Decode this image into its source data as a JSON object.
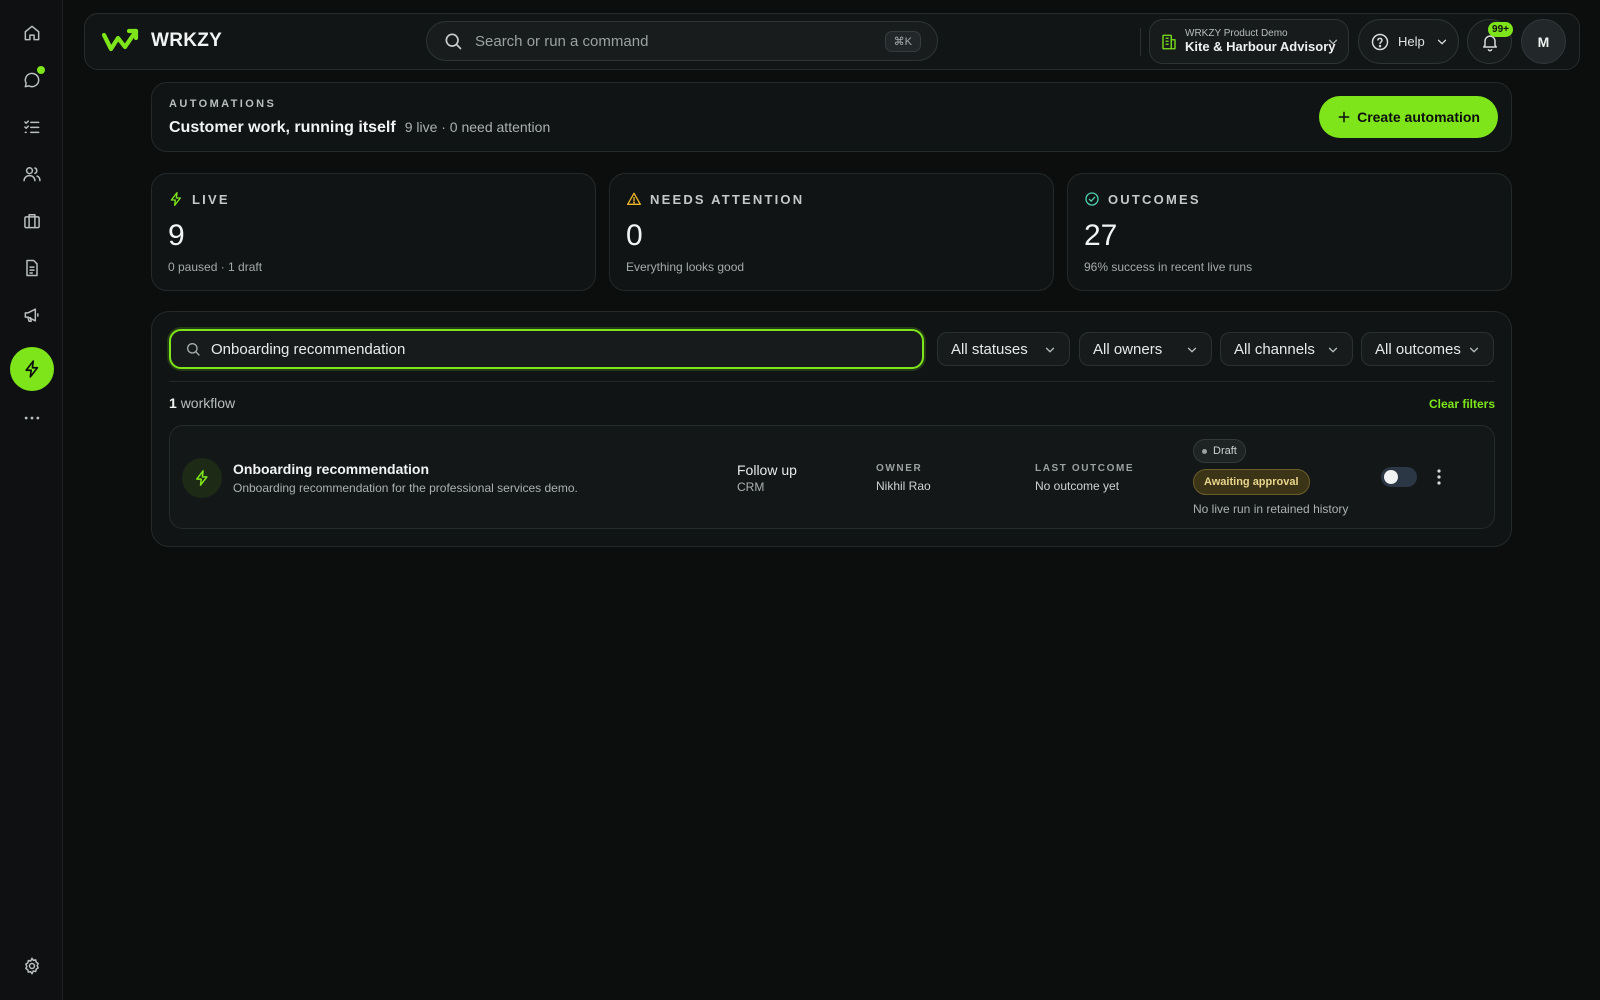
{
  "brand": {
    "name": "WRKZY"
  },
  "command_bar": {
    "placeholder": "Search or run a command",
    "shortcut": "⌘K"
  },
  "workspace": {
    "label_small": "WRKZY Product Demo",
    "name": "Kite & Harbour Advisory"
  },
  "help": {
    "label": "Help"
  },
  "notifications": {
    "badge": "99+"
  },
  "user": {
    "initial": "M"
  },
  "rail": {
    "items": [
      {
        "icon": "home-icon"
      },
      {
        "icon": "chat-icon",
        "has_dot": true
      },
      {
        "icon": "tasks-icon"
      },
      {
        "icon": "contacts-icon"
      },
      {
        "icon": "briefcase-icon"
      },
      {
        "icon": "document-icon"
      },
      {
        "icon": "megaphone-icon"
      },
      {
        "icon": "lightning-icon",
        "active": true
      },
      {
        "icon": "more-icon"
      }
    ],
    "bottom": {
      "icon": "settings-icon"
    }
  },
  "header": {
    "eyebrow": "AUTOMATIONS",
    "title": "Customer work, running itself",
    "summary": "9 live · 0 need attention",
    "create_label": "Create automation"
  },
  "stats": [
    {
      "icon": "lightning-icon",
      "label": "LIVE",
      "value": "9",
      "sub": "0 paused · 1 draft",
      "color": "#7ee51a"
    },
    {
      "icon": "warning-icon",
      "label": "NEEDS ATTENTION",
      "value": "0",
      "sub": "Everything looks good",
      "color": "#f0b428"
    },
    {
      "icon": "check-circle-icon",
      "label": "OUTCOMES",
      "value": "27",
      "sub": "96% success in recent live runs",
      "color": "#4ecdb0"
    }
  ],
  "filters": {
    "search_value": "Onboarding recommendation",
    "statuses": "All statuses",
    "owners": "All owners",
    "channels": "All channels",
    "outcomes": "All outcomes"
  },
  "results": {
    "count": "1",
    "unit": "workflow",
    "clear_label": "Clear filters"
  },
  "workflows": [
    {
      "title": "Onboarding recommendation",
      "description": "Onboarding recommendation for the professional services demo.",
      "action": "Follow up",
      "channel": "CRM",
      "owner_label": "OWNER",
      "owner": "Nikhil Rao",
      "outcome_label": "LAST OUTCOME",
      "outcome": "No outcome yet",
      "status": "Draft",
      "approval": "Awaiting approval",
      "history": "No live run in retained history",
      "enabled": false
    }
  ],
  "colors": {
    "accent": "#7ee51a",
    "background": "#0c0e0e",
    "warning": "#f0b428",
    "success": "#4ecdb0"
  }
}
